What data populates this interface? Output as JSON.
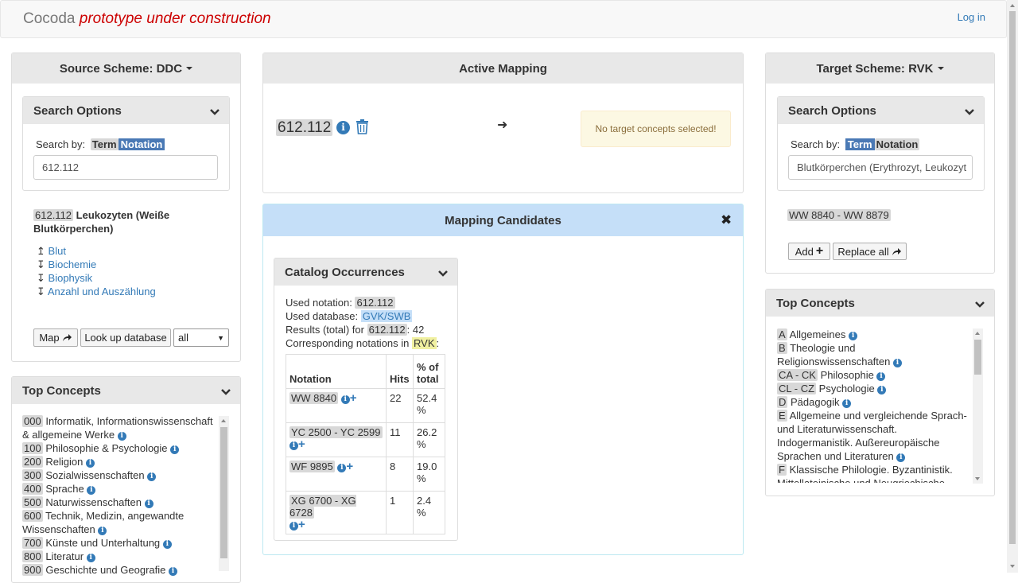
{
  "app": {
    "name": "Cocoda",
    "subtitle": "prototype under construction",
    "login": "Log in"
  },
  "source": {
    "header": "Source Scheme: DDC",
    "search_options": {
      "title": "Search Options",
      "search_by": "Search by:",
      "term": "Term",
      "notation": "Notation",
      "input_value": "612.112"
    },
    "concept": {
      "notation": "612.112",
      "label": "Leukozyten (Weiße Blutkörperchen)"
    },
    "related": [
      {
        "arrow": "↥",
        "label": "Blut"
      },
      {
        "arrow": "↧",
        "label": "Biochemie"
      },
      {
        "arrow": "↧",
        "label": "Biophysik"
      },
      {
        "arrow": "↧",
        "label": "Anzahl und Auszählung"
      }
    ],
    "buttons": {
      "map": "Map",
      "lookup": "Look up database",
      "select": "all"
    },
    "top_concepts": {
      "title": "Top Concepts",
      "items": [
        {
          "notation": "000",
          "label": "Informatik, Informationswissenschaft & allgemeine Werke"
        },
        {
          "notation": "100",
          "label": "Philosophie & Psychologie"
        },
        {
          "notation": "200",
          "label": "Religion"
        },
        {
          "notation": "300",
          "label": "Sozialwissenschaften"
        },
        {
          "notation": "400",
          "label": "Sprache"
        },
        {
          "notation": "500",
          "label": "Naturwissenschaften"
        },
        {
          "notation": "600",
          "label": "Technik, Medizin, angewandte Wissenschaften"
        },
        {
          "notation": "700",
          "label": "Künste und Unterhaltung"
        },
        {
          "notation": "800",
          "label": "Literatur"
        },
        {
          "notation": "900",
          "label": "Geschichte und Geografie"
        }
      ]
    }
  },
  "active_mapping": {
    "title": "Active Mapping",
    "source_notation": "612.112",
    "arrow": "➜",
    "warning": "No target concepts selected!"
  },
  "candidates": {
    "title": "Mapping Candidates",
    "close": "✖",
    "catalog": {
      "title": "Catalog Occurrences",
      "used_notation_label": "Used notation:",
      "used_notation": "612.112",
      "used_database_label": "Used database:",
      "used_database": "GVK/SWB",
      "results_label": "Results (total) for",
      "results_notation": "612.112",
      "results_count": ": 42",
      "corresponding_label": "Corresponding notations in",
      "corresponding_scheme": "RVK",
      "corresponding_colon": ":",
      "columns": {
        "notation": "Notation",
        "hits": "Hits",
        "pct": "% of total"
      },
      "rows": [
        {
          "notation": "WW 8840",
          "hits": "22",
          "pct": "52.4 %"
        },
        {
          "notation": "YC 2500 - YC 2599",
          "hits": "11",
          "pct": "26.2 %"
        },
        {
          "notation": "WF 9895",
          "hits": "8",
          "pct": "19.0 %"
        },
        {
          "notation": "XG 6700 - XG 6728",
          "hits": "1",
          "pct": "2.4 %"
        }
      ]
    }
  },
  "target": {
    "header": "Target Scheme: RVK",
    "search_options": {
      "title": "Search Options",
      "search_by": "Search by:",
      "term": "Term",
      "notation": "Notation",
      "input_value": "Blutkörperchen (Erythrozyt, Leukozyt"
    },
    "concept": {
      "notation": "WW 8840 - WW 8879"
    },
    "buttons": {
      "add": "Add",
      "replace": "Replace all"
    },
    "top_concepts": {
      "title": "Top Concepts",
      "items": [
        {
          "notation": "A",
          "label": "Allgemeines"
        },
        {
          "notation": "B",
          "label": "Theologie und Religionswissenschaften"
        },
        {
          "notation": "CA - CK",
          "label": "Philosophie"
        },
        {
          "notation": "CL - CZ",
          "label": "Psychologie"
        },
        {
          "notation": "D",
          "label": "Pädagogik"
        },
        {
          "notation": "E",
          "label": "Allgemeine und vergleichende Sprach- und Literaturwissenschaft. Indogermanistik. Außereuropäische Sprachen und Literaturen"
        },
        {
          "notation": "F",
          "label": "Klassische Philologie. Byzantinistik. Mittellateinische und Neugriechische"
        }
      ]
    }
  }
}
